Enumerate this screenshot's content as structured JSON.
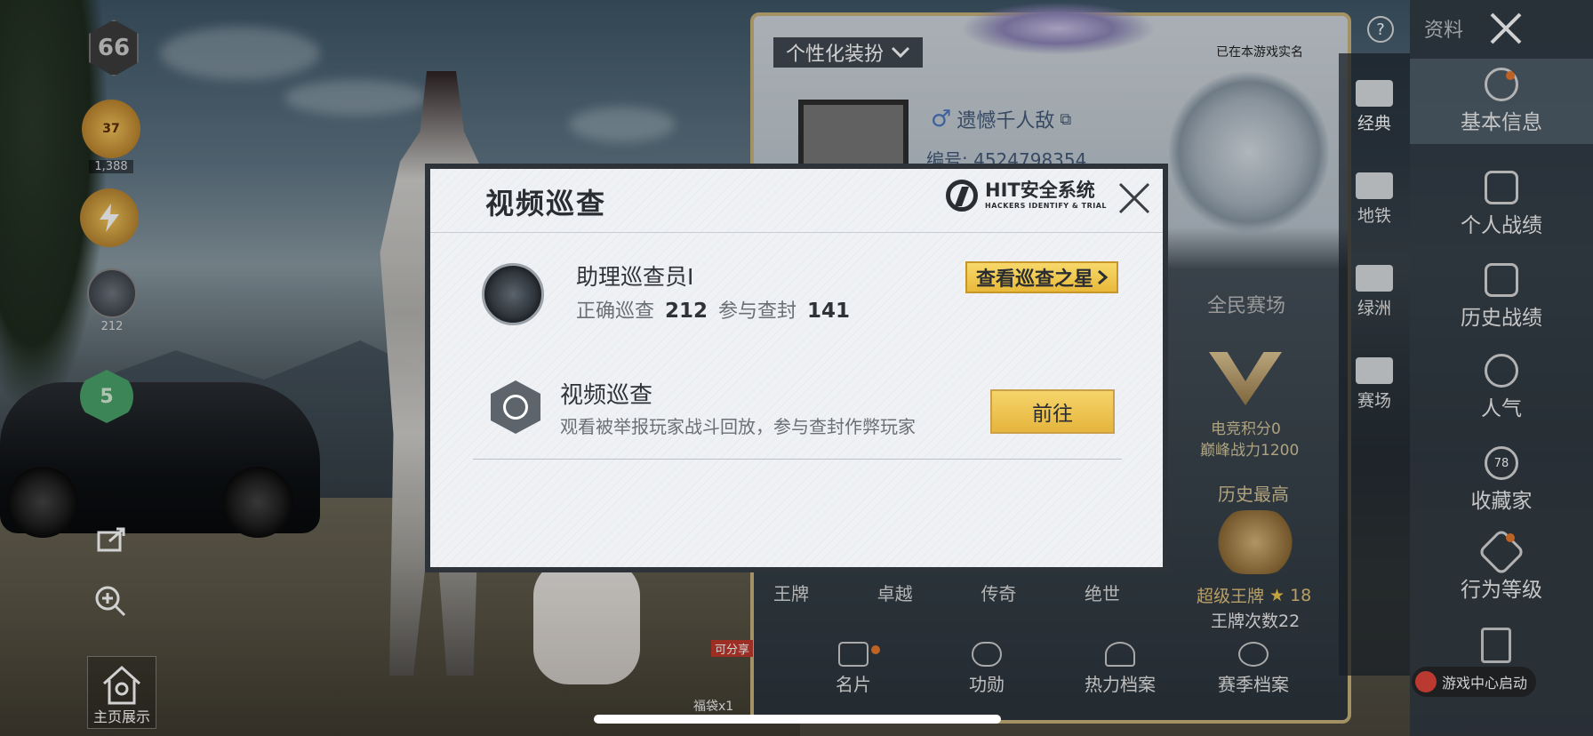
{
  "left_hud": {
    "level": "66",
    "trophy_value": "37",
    "trophy_points": "1,388",
    "emblem_count": "212",
    "shield_value": "5",
    "home_label": "主页展示"
  },
  "profile": {
    "customize_label": "个性化装扮",
    "realname_note": "已在本游戏实名",
    "player_name": "遗憾千人敌",
    "player_id": "编号: 4524798354",
    "mode_title": "全民赛场",
    "esports_points": "电竞积分0",
    "peak_power": "巅峰战力1200",
    "history_title": "历史最高",
    "history_rank": "超级王牌",
    "history_stars": "18",
    "ace_count": "王牌次数22",
    "tiers": [
      "王牌",
      "卓越",
      "传奇",
      "绝世"
    ],
    "bottom_tabs": [
      "名片",
      "功勋",
      "热力档案",
      "赛季档案"
    ],
    "share_badge": "可分享",
    "lucky_bag": "福袋x1"
  },
  "mode_nav": {
    "items": [
      "经典",
      "地铁",
      "绿洲",
      "赛场"
    ]
  },
  "info_nav": {
    "header_label": "资料",
    "items": [
      "基本信息",
      "个人战绩",
      "历史战绩",
      "人气",
      "收藏家",
      "行为等级"
    ],
    "collector_level": "78",
    "game_center": "游戏中心启动"
  },
  "modal": {
    "title": "视频巡查",
    "logo_name": "HIT安全系统",
    "logo_sub": "HACKERS IDENTIFY & TRIAL",
    "inspector_title": "助理巡查员I",
    "correct_label": "正确巡查",
    "correct_value": "212",
    "banned_label": "参与查封",
    "banned_value": "141",
    "stars_button": "查看巡查之星",
    "review_title": "视频巡查",
    "review_desc": "观看被举报玩家战斗回放，参与查封作弊玩家",
    "go_button": "前往"
  },
  "colors": {
    "accent_gold": "#e8b93a",
    "modal_bg": "#eff1f4",
    "frame_gold": "#c9b27a",
    "notif_orange": "#e8792b"
  }
}
